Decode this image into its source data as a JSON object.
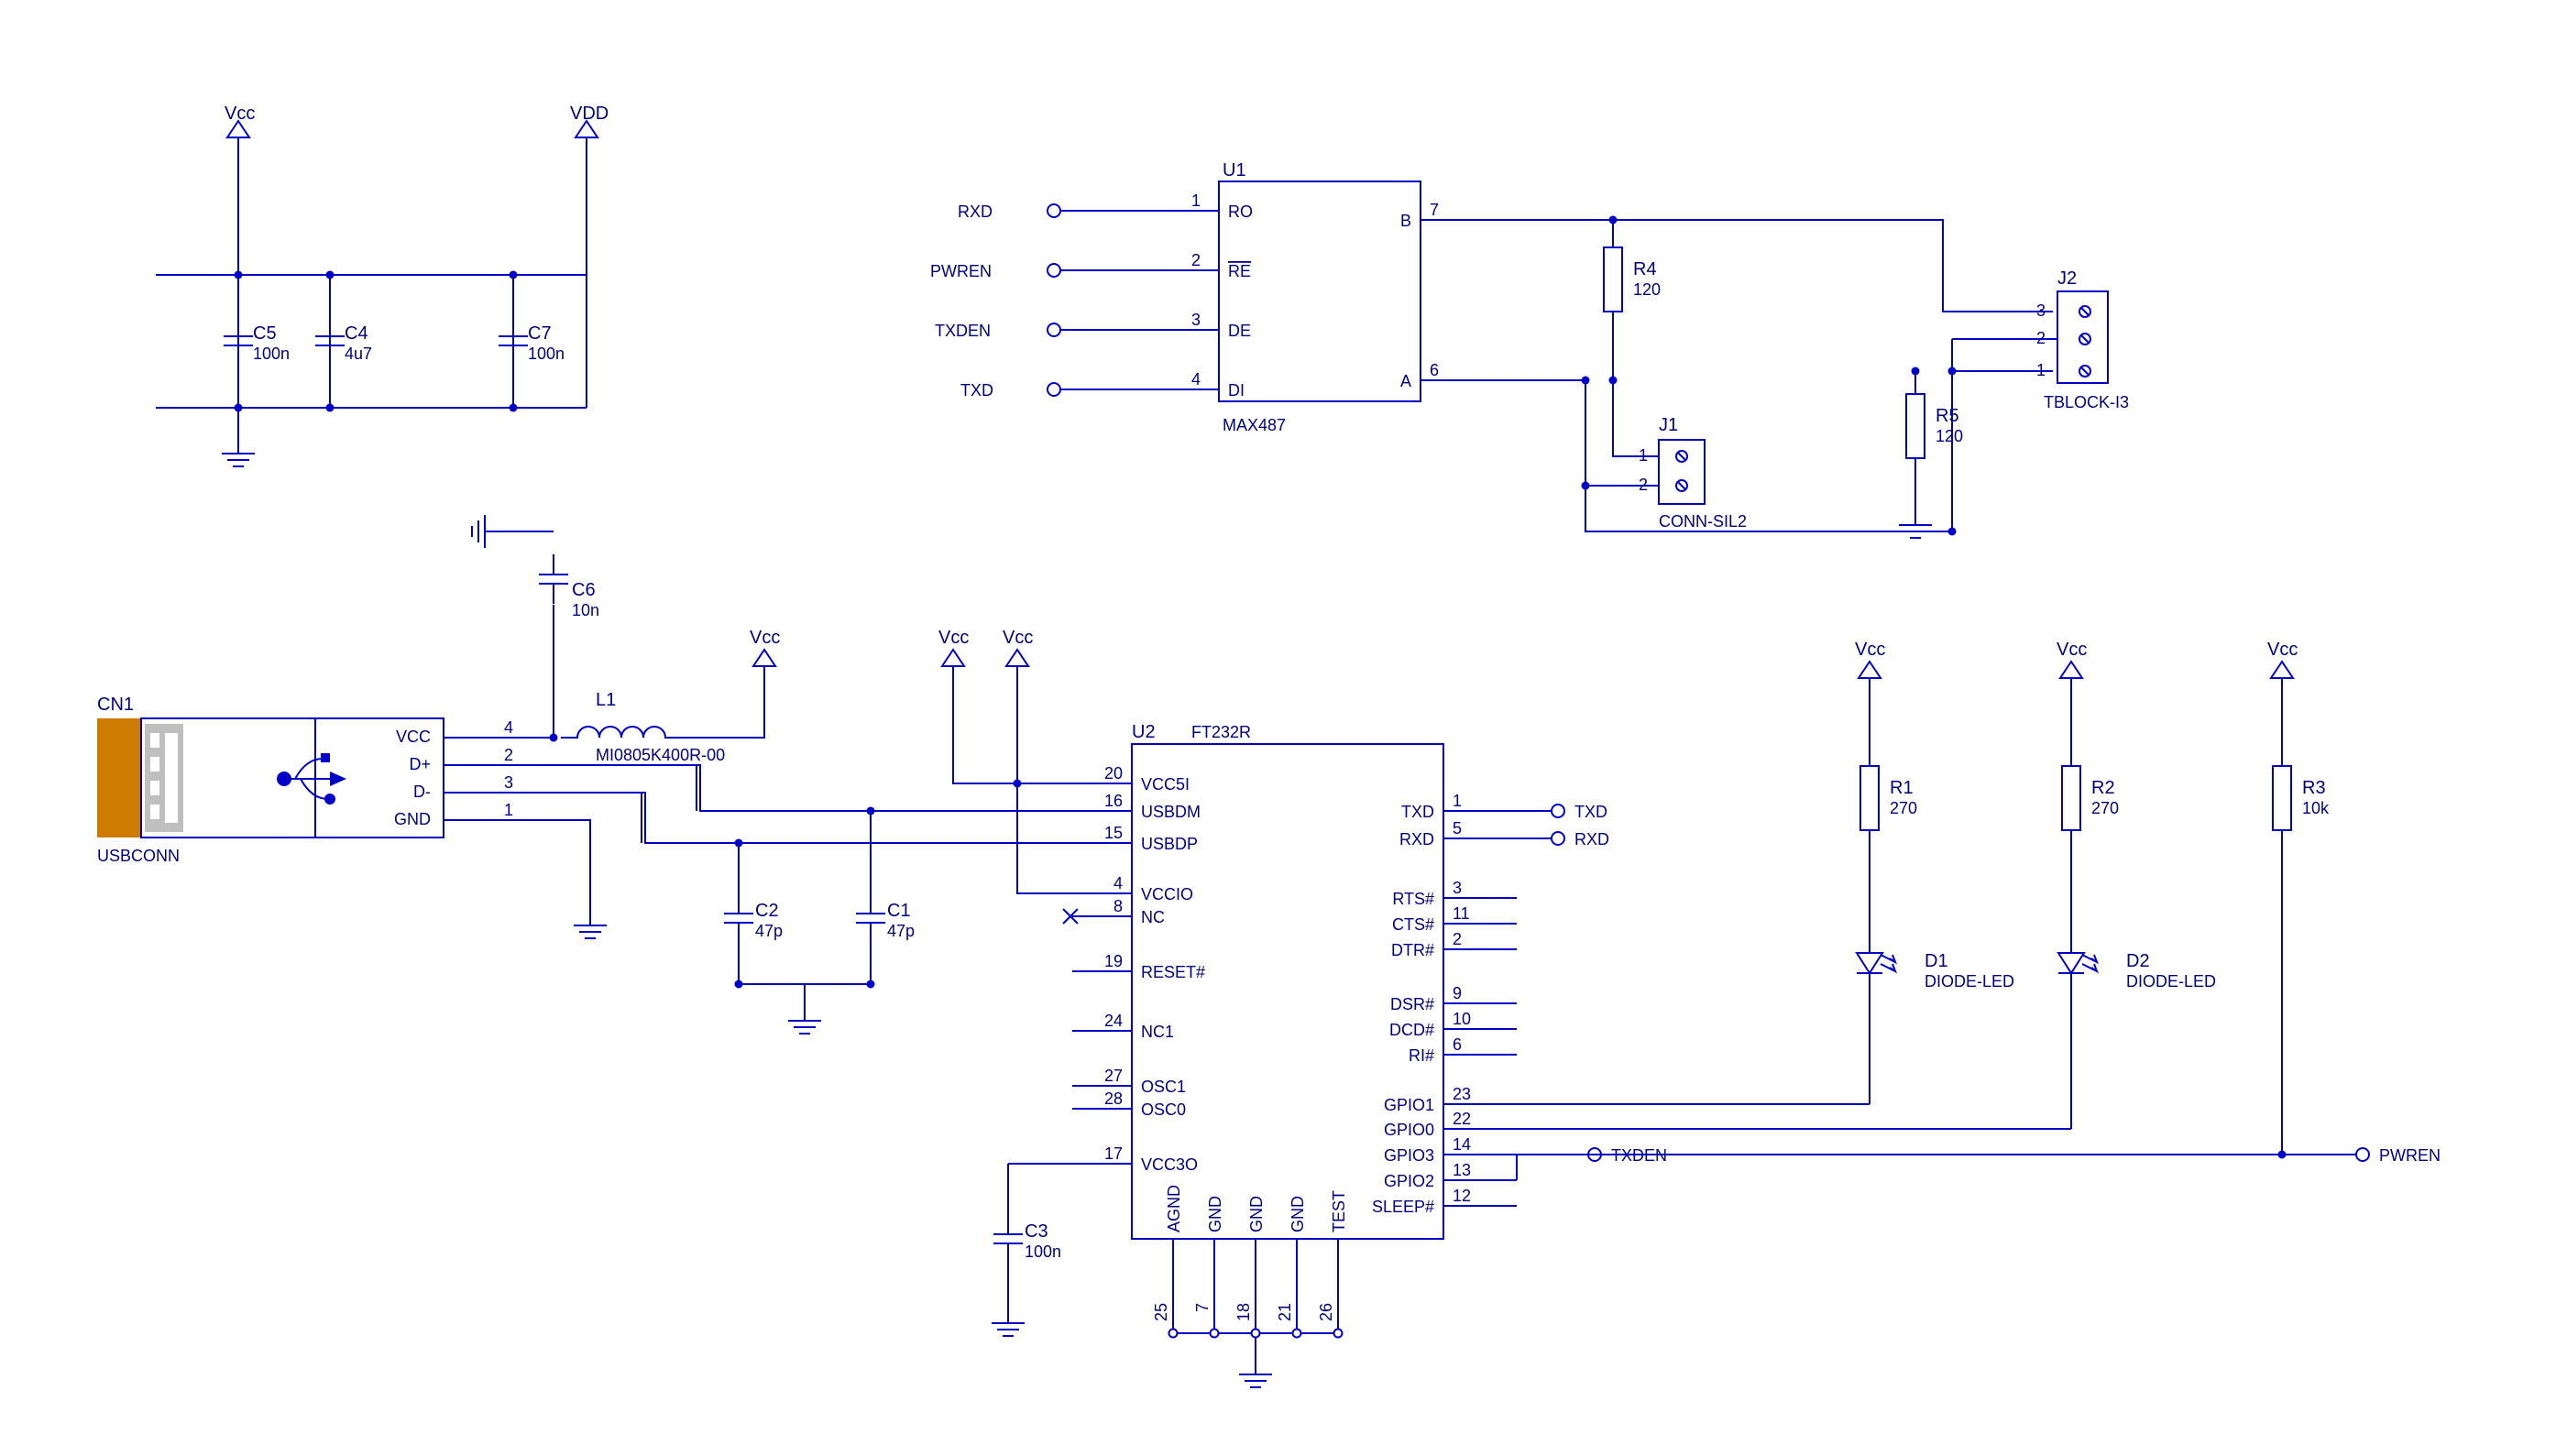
{
  "power": {
    "vcc": "Vcc",
    "vdd": "VDD"
  },
  "caps": {
    "C1": {
      "ref": "C1",
      "val": "47p"
    },
    "C2": {
      "ref": "C2",
      "val": "47p"
    },
    "C3": {
      "ref": "C3",
      "val": "100n"
    },
    "C4": {
      "ref": "C4",
      "val": "4u7"
    },
    "C5": {
      "ref": "C5",
      "val": "100n"
    },
    "C6": {
      "ref": "C6",
      "val": "10n"
    },
    "C7": {
      "ref": "C7",
      "val": "100n"
    }
  },
  "inductors": {
    "L1": {
      "ref": "L1",
      "val": "MI0805K400R-00"
    }
  },
  "resistors": {
    "R1": {
      "ref": "R1",
      "val": "270"
    },
    "R2": {
      "ref": "R2",
      "val": "270"
    },
    "R3": {
      "ref": "R3",
      "val": "10k"
    },
    "R4": {
      "ref": "R4",
      "val": "120"
    },
    "R5": {
      "ref": "R5",
      "val": "120"
    }
  },
  "diodes": {
    "D1": {
      "ref": "D1",
      "val": "DIODE-LED"
    },
    "D2": {
      "ref": "D2",
      "val": "DIODE-LED"
    }
  },
  "connectors": {
    "CN1": {
      "ref": "CN1",
      "val": "USBCONN",
      "pins": {
        "vcc": "VCC",
        "dp": "D+",
        "dm": "D-",
        "gnd": "GND",
        "p4": "4",
        "p3": "3",
        "p2": "2",
        "p1": "1"
      }
    },
    "J1": {
      "ref": "J1",
      "val": "CONN-SIL2",
      "p1": "1",
      "p2": "2"
    },
    "J2": {
      "ref": "J2",
      "val": "TBLOCK-I3",
      "p1": "1",
      "p2": "2",
      "p3": "3"
    }
  },
  "ics": {
    "U1": {
      "ref": "U1",
      "val": "MAX487",
      "pins": {
        "RO": "RO",
        "RE": "RE",
        "DE": "DE",
        "DI": "DI",
        "B": "B",
        "A": "A",
        "p1": "1",
        "p2": "2",
        "p3": "3",
        "p4": "4",
        "p7": "7",
        "p6": "6"
      }
    },
    "U2": {
      "ref": "U2",
      "val": "FT232R",
      "left": {
        "VCC5I": {
          "n": "VCC5I",
          "p": "20"
        },
        "USBDM": {
          "n": "USBDM",
          "p": "16"
        },
        "USBDP": {
          "n": "USBDP",
          "p": "15"
        },
        "VCCIO": {
          "n": "VCCIO",
          "p": "4"
        },
        "NC": {
          "n": "NC",
          "p": "8"
        },
        "RESET": {
          "n": "RESET#",
          "p": "19"
        },
        "NC1": {
          "n": "NC1",
          "p": "24"
        },
        "OSC1": {
          "n": "OSC1",
          "p": "27"
        },
        "OSC0": {
          "n": "OSC0",
          "p": "28"
        },
        "VCC3O": {
          "n": "VCC3O",
          "p": "17"
        }
      },
      "right": {
        "TXD": {
          "n": "TXD",
          "p": "1"
        },
        "RXD": {
          "n": "RXD",
          "p": "5"
        },
        "RTS": {
          "n": "RTS#",
          "p": "3"
        },
        "CTS": {
          "n": "CTS#",
          "p": "11"
        },
        "DTR": {
          "n": "DTR#",
          "p": "2"
        },
        "DSR": {
          "n": "DSR#",
          "p": "9"
        },
        "DCD": {
          "n": "DCD#",
          "p": "10"
        },
        "RI": {
          "n": "RI#",
          "p": "6"
        },
        "GPIO1": {
          "n": "GPIO1",
          "p": "23"
        },
        "GPIO0": {
          "n": "GPIO0",
          "p": "22"
        },
        "GPIO3": {
          "n": "GPIO3",
          "p": "14"
        },
        "GPIO2": {
          "n": "GPIO2",
          "p": "13"
        },
        "SLEEP": {
          "n": "SLEEP#",
          "p": "12"
        }
      },
      "bottom": {
        "AGND": {
          "n": "AGND",
          "p": "25"
        },
        "GND1": {
          "n": "GND",
          "p": "7"
        },
        "GND2": {
          "n": "GND",
          "p": "18"
        },
        "GND3": {
          "n": "GND",
          "p": "21"
        },
        "TEST": {
          "n": "TEST",
          "p": "26"
        }
      }
    }
  },
  "nets": {
    "RXD": "RXD",
    "PWREN": "PWREN",
    "TXDEN": "TXDEN",
    "TXD": "TXD"
  }
}
